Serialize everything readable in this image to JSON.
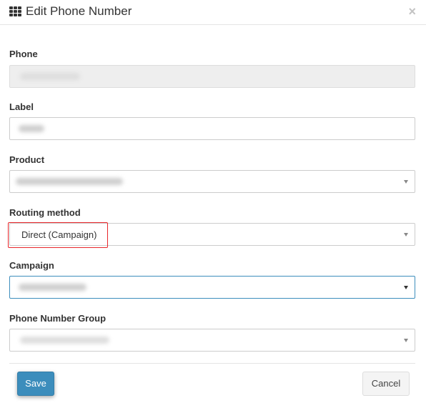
{
  "modal": {
    "title": "Edit Phone Number",
    "close_label": "×"
  },
  "fields": {
    "phone": {
      "label": "Phone"
    },
    "label": {
      "label": "Label"
    },
    "product": {
      "label": "Product"
    },
    "routing": {
      "label": "Routing method",
      "value": "Direct (Campaign)"
    },
    "campaign": {
      "label": "Campaign"
    },
    "group": {
      "label": "Phone Number Group"
    }
  },
  "footer": {
    "save_label": "Save",
    "cancel_label": "Cancel"
  },
  "colors": {
    "primary": "#3c8dbc",
    "highlight": "#e8262a"
  },
  "icons": {
    "title_icon": "grid-icon",
    "dropdown": "caret-down-icon"
  }
}
